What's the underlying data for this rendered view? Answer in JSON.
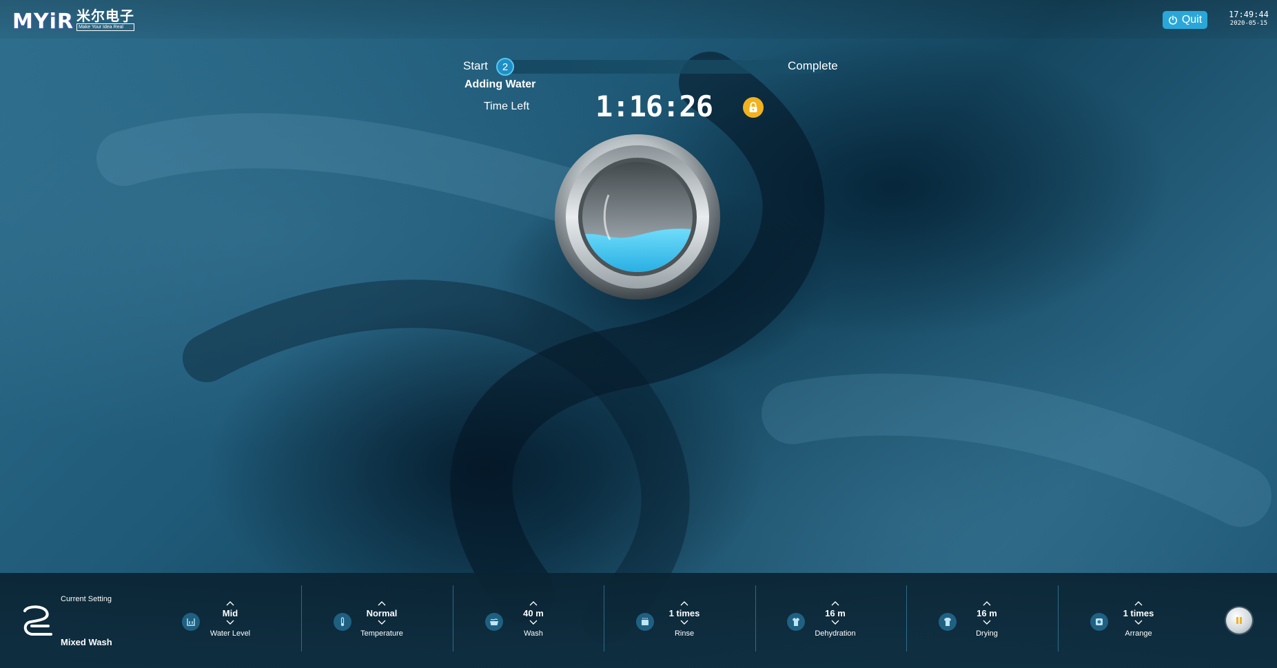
{
  "header": {
    "logo": {
      "main": "MYiR",
      "cn": "米尔电子",
      "tagline": "Make Your Idea Real"
    },
    "quit_label": "Quit",
    "clock": {
      "time": "17:49:44",
      "date": "2020-05-15"
    }
  },
  "progress": {
    "start_label": "Start",
    "current_step": "2",
    "complete_label": "Complete",
    "status": "Adding Water"
  },
  "timer": {
    "label": "Time Left",
    "value": "1:16:26"
  },
  "colors": {
    "accent": "#2aa7d8",
    "lock": "#f1b21f",
    "water": "#35c8f3"
  },
  "icons": {
    "quit": "power-icon",
    "lock": "lock-icon",
    "pause": "pause-icon",
    "mode": "mixed-wash-icon"
  },
  "current_setting": {
    "label": "Current Setting",
    "mode": "Mixed Wash"
  },
  "settings": [
    {
      "value": "Mid",
      "label": "Water Level",
      "icon": "water-level-icon"
    },
    {
      "value": "Normal",
      "label": "Temperature",
      "icon": "thermometer-icon"
    },
    {
      "value": "40 m",
      "label": "Wash",
      "icon": "wash-tub-icon"
    },
    {
      "value": "1 times",
      "label": "Rinse",
      "icon": "rinse-icon"
    },
    {
      "value": "16 m",
      "label": "Dehydration",
      "icon": "spin-icon"
    },
    {
      "value": "16 m",
      "label": "Drying",
      "icon": "shirt-icon"
    },
    {
      "value": "1 times",
      "label": "Arrange",
      "icon": "arrange-icon"
    }
  ]
}
